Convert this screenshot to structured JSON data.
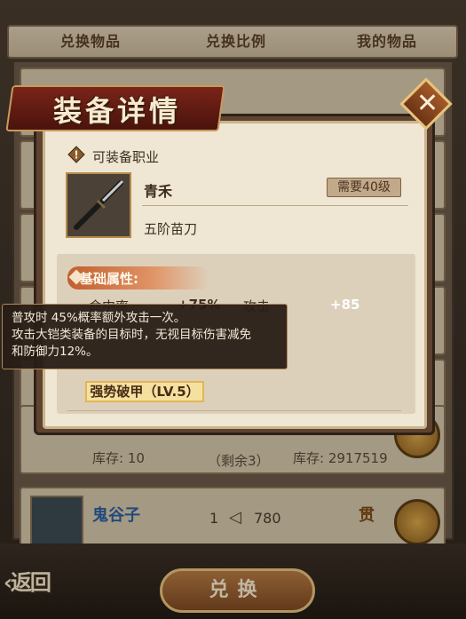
{
  "tabs": [
    "兑换物品",
    "兑换比例",
    "我的物品"
  ],
  "list": {
    "row_mid": {
      "stock_left": "库存: 10",
      "remain": "（剩余3）",
      "stock_right": "库存: 2917519"
    },
    "row_bottom": {
      "name": "鬼谷子",
      "ratio_left": "1",
      "ratio_right": "780",
      "coin_label": "贯"
    }
  },
  "modal": {
    "title": "装备详情",
    "job_label": "可装备职业",
    "item": {
      "name": "青禾",
      "level_req": "需要40级",
      "type": "五阶苗刀"
    },
    "attributes": {
      "header": "基础属性:",
      "rows": [
        {
          "label": "命中率",
          "value": "+75%"
        },
        {
          "label": "攻击",
          "value": "+85"
        }
      ]
    },
    "skill": {
      "label": "强势破甲（LV.5）"
    }
  },
  "tooltip": {
    "line1": "普攻时 45%概率额外攻击一次。",
    "line2": "攻击大铠类装备的目标时，无视目标伤害减免",
    "line3": "和防御力12%。"
  },
  "bottom": {
    "back_label": "返回",
    "confirm_label": "兑换"
  },
  "colors": {
    "accent": "#7a2418",
    "gold": "#e5c07c",
    "panel": "#efe6d3"
  }
}
